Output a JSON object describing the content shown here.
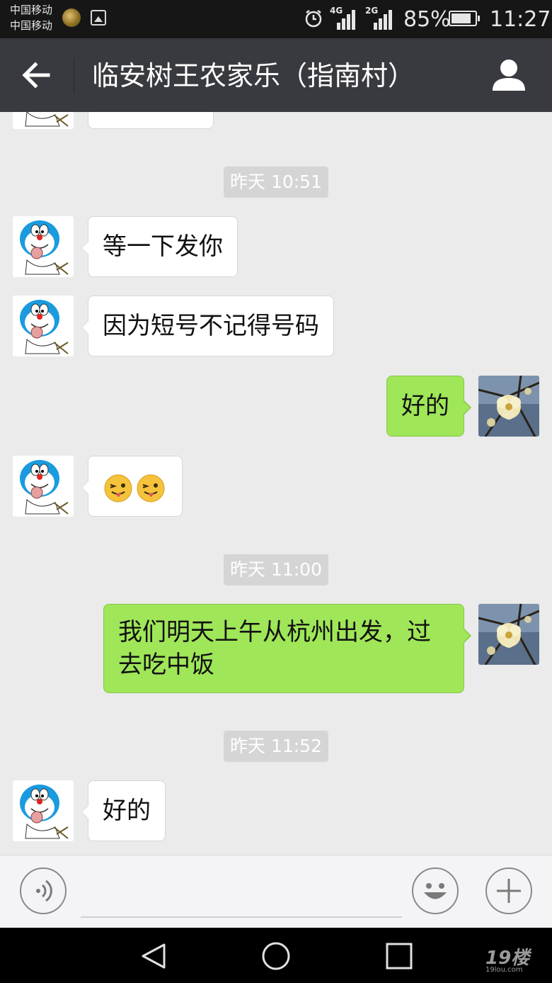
{
  "status_bar": {
    "carrier_1": "中国移动",
    "carrier_2": "中国移动",
    "network_1": "4G",
    "network_2": "2G",
    "battery": "85%",
    "battery_level": 0.85,
    "time": "11:27"
  },
  "header": {
    "title": "临安树王农家乐（指南村）",
    "back_icon": "arrow-left-icon",
    "profile_icon": "person-icon"
  },
  "chat": {
    "messages": [
      {
        "type": "timestamp",
        "text": "昨天 10:51"
      },
      {
        "type": "incoming",
        "text": "等一下发你"
      },
      {
        "type": "incoming",
        "text": "因为短号不记得号码"
      },
      {
        "type": "outgoing",
        "text": "好的"
      },
      {
        "type": "incoming",
        "emoji": "tongue-wink-emoji",
        "emoji_count": 2
      },
      {
        "type": "timestamp",
        "text": "昨天 11:00"
      },
      {
        "type": "outgoing",
        "lines": [
          "我们明天上午从杭州出发，过",
          "去吃中饭"
        ]
      },
      {
        "type": "timestamp",
        "text": "昨天 11:52"
      },
      {
        "type": "incoming",
        "text": "好的"
      }
    ]
  },
  "input_bar": {
    "voice_icon": "voice-icon",
    "emoji_icon": "smiley-icon",
    "plus_icon": "plus-icon",
    "placeholder": ""
  },
  "nav_bar": {
    "back_icon": "triangle-back-icon",
    "home_icon": "circle-home-icon",
    "recents_icon": "square-recents-icon",
    "watermark": "19楼",
    "watermark_sub": "19lou.com"
  },
  "colors": {
    "title_bar": "#393a3f",
    "chat_bg": "#ebebeb",
    "outgoing_bubble": "#9fe658",
    "incoming_bubble": "#ffffff"
  }
}
